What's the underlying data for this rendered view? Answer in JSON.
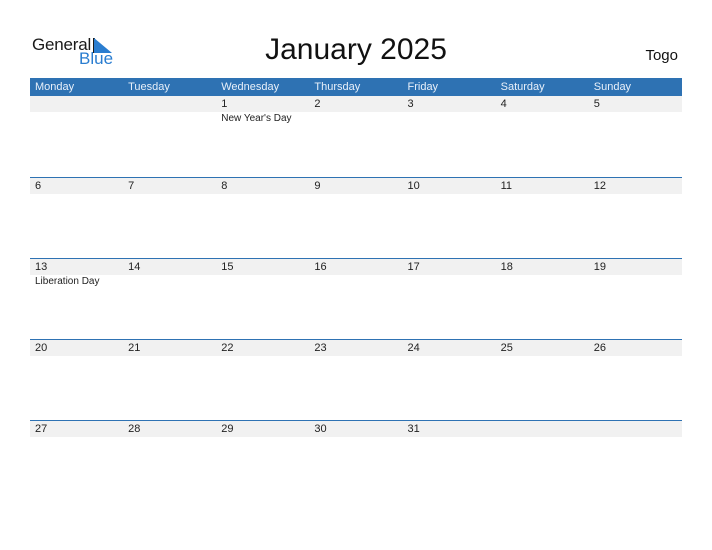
{
  "logo": {
    "general": "General",
    "blue": "Blue",
    "accent_color": "#2a7dd0"
  },
  "title": "January 2025",
  "country": "Togo",
  "header_color": "#2e72b3",
  "weekdays": [
    "Monday",
    "Tuesday",
    "Wednesday",
    "Thursday",
    "Friday",
    "Saturday",
    "Sunday"
  ],
  "weeks": [
    [
      {
        "day": ""
      },
      {
        "day": ""
      },
      {
        "day": "1",
        "event": "New Year's Day"
      },
      {
        "day": "2"
      },
      {
        "day": "3"
      },
      {
        "day": "4"
      },
      {
        "day": "5"
      }
    ],
    [
      {
        "day": "6"
      },
      {
        "day": "7"
      },
      {
        "day": "8"
      },
      {
        "day": "9"
      },
      {
        "day": "10"
      },
      {
        "day": "11"
      },
      {
        "day": "12"
      }
    ],
    [
      {
        "day": "13",
        "event": "Liberation Day"
      },
      {
        "day": "14"
      },
      {
        "day": "15"
      },
      {
        "day": "16"
      },
      {
        "day": "17"
      },
      {
        "day": "18"
      },
      {
        "day": "19"
      }
    ],
    [
      {
        "day": "20"
      },
      {
        "day": "21"
      },
      {
        "day": "22"
      },
      {
        "day": "23"
      },
      {
        "day": "24"
      },
      {
        "day": "25"
      },
      {
        "day": "26"
      }
    ],
    [
      {
        "day": "27"
      },
      {
        "day": "28"
      },
      {
        "day": "29"
      },
      {
        "day": "30"
      },
      {
        "day": "31"
      },
      {
        "day": ""
      },
      {
        "day": ""
      }
    ]
  ]
}
